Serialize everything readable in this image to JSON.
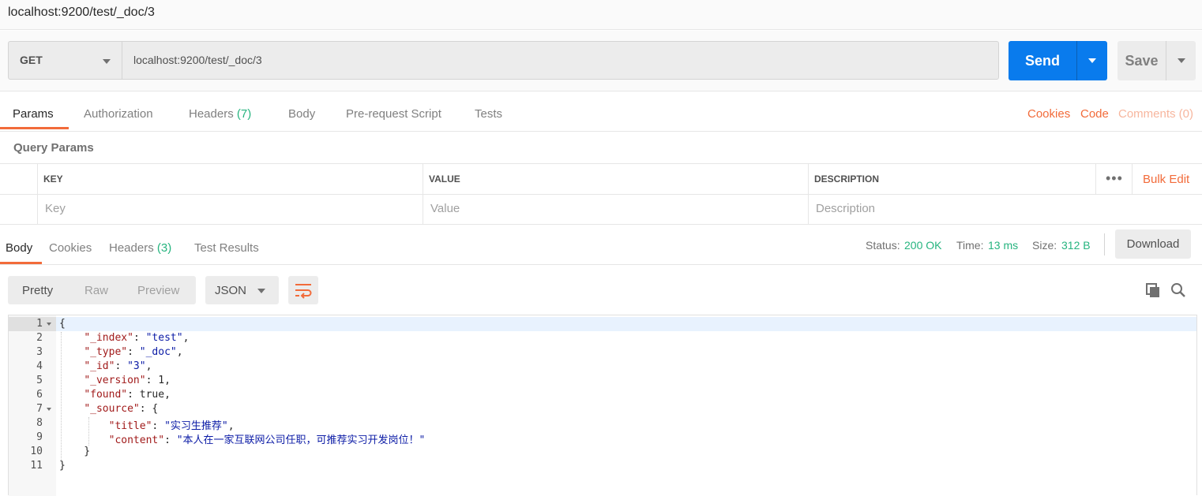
{
  "window": {
    "title": "localhost:9200/test/_doc/3"
  },
  "request": {
    "method": "GET",
    "url": "localhost:9200/test/_doc/3",
    "send_label": "Send",
    "save_label": "Save"
  },
  "request_tabs": {
    "params": "Params",
    "authorization": "Authorization",
    "headers": "Headers",
    "headers_count": "(7)",
    "body": "Body",
    "prerequest": "Pre-request Script",
    "tests": "Tests",
    "cookies": "Cookies",
    "code": "Code",
    "comments": "Comments (0)"
  },
  "query_params": {
    "title": "Query Params",
    "columns": {
      "key": "KEY",
      "value": "VALUE",
      "description": "DESCRIPTION"
    },
    "placeholders": {
      "key": "Key",
      "value": "Value",
      "description": "Description"
    },
    "more": "•••",
    "bulk_edit": "Bulk Edit"
  },
  "response_tabs": {
    "body": "Body",
    "cookies": "Cookies",
    "headers": "Headers",
    "headers_count": "(3)",
    "test_results": "Test Results"
  },
  "response_status": {
    "status_label": "Status:",
    "status_value": "200 OK",
    "time_label": "Time:",
    "time_value": "13 ms",
    "size_label": "Size:",
    "size_value": "312 B",
    "download": "Download"
  },
  "body_toolbar": {
    "pretty": "Pretty",
    "raw": "Raw",
    "preview": "Preview",
    "format": "JSON"
  },
  "editor": {
    "line_numbers": [
      "1",
      "2",
      "3",
      "4",
      "5",
      "6",
      "7",
      "8",
      "9",
      "10",
      "11"
    ],
    "json": {
      "index_key": "\"_index\"",
      "index_val": "\"test\"",
      "type_key": "\"_type\"",
      "type_val": "\"_doc\"",
      "id_key": "\"_id\"",
      "id_val": "\"3\"",
      "version_key": "\"_version\"",
      "version_val": "1",
      "found_key": "\"found\"",
      "found_val": "true",
      "source_key": "\"_source\"",
      "title_key": "\"title\"",
      "title_val": "\"实习生推荐\"",
      "content_key": "\"content\"",
      "content_val": "\"本人在一家互联网公司任职，可推荐实习开发岗位！\""
    }
  },
  "icons": [
    "chevron-down-icon",
    "wrap-lines-icon",
    "copy-icon",
    "search-icon",
    "fold-arrow-icon"
  ],
  "colors": {
    "accent": "#f26b3a",
    "send_button": "#097bed",
    "success": "#26b47f",
    "json_key": "#a11b1b",
    "json_string": "#0b1ba6"
  }
}
